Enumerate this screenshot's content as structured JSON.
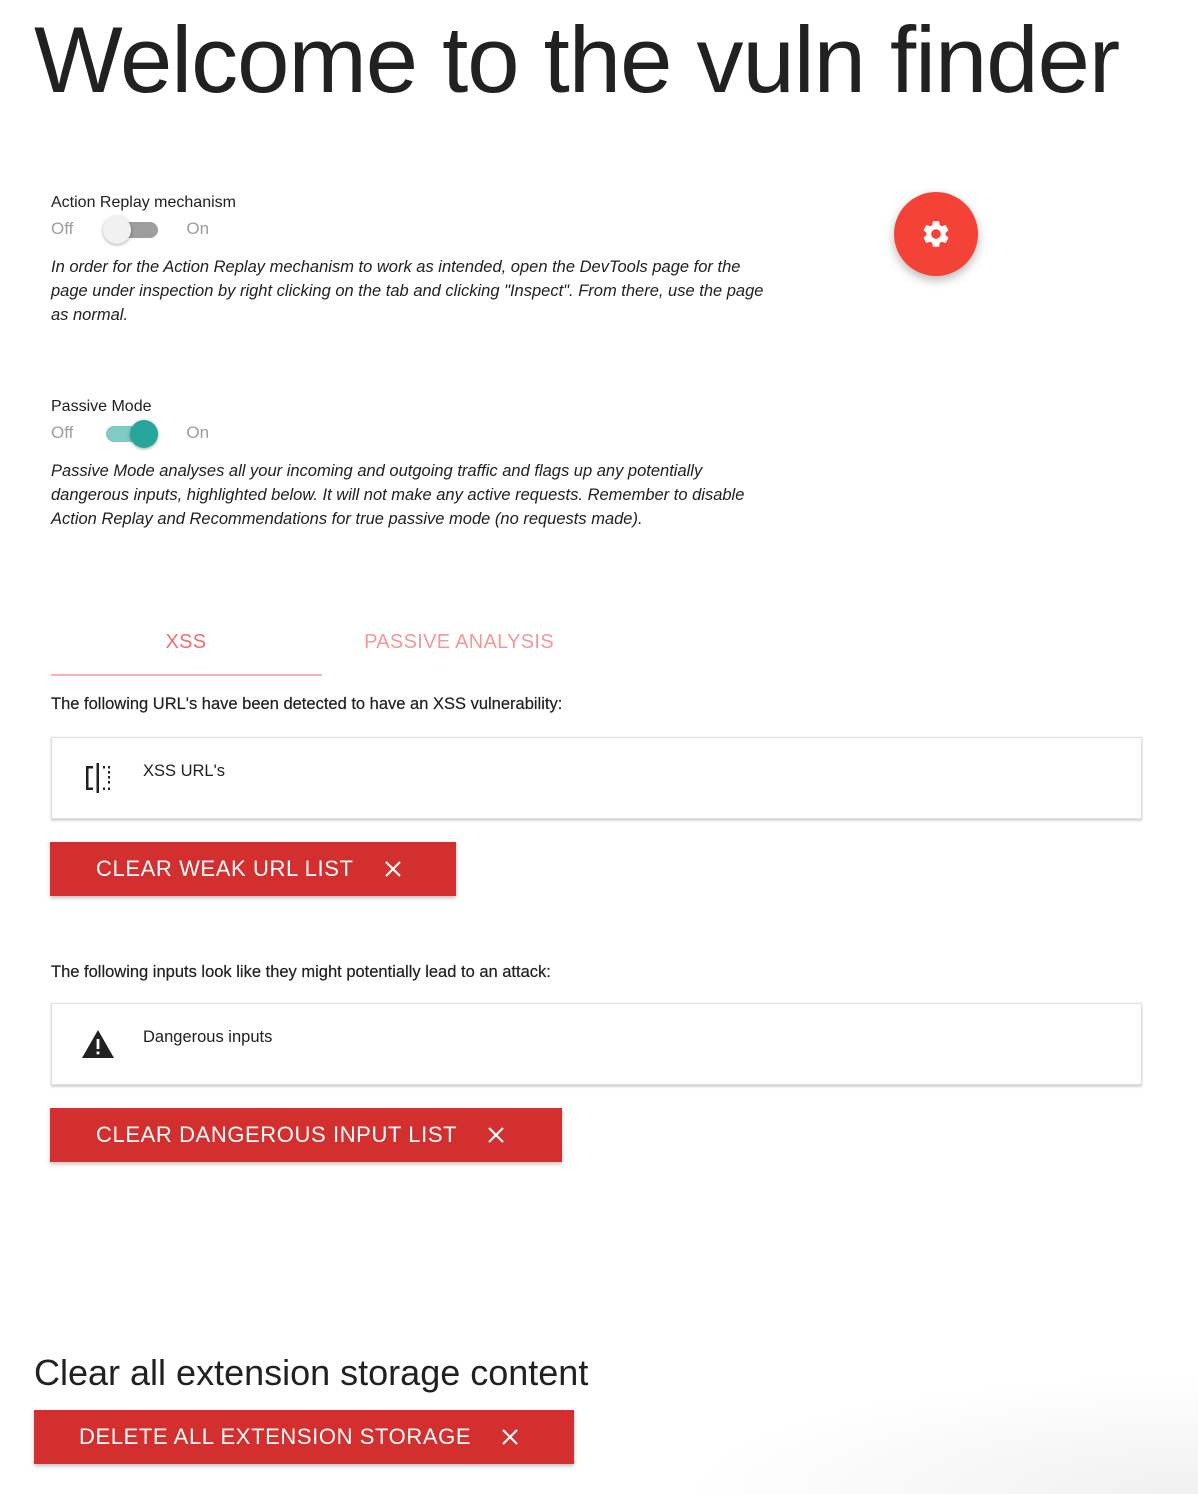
{
  "page": {
    "title": "Welcome to the vuln finder"
  },
  "action_replay": {
    "label": "Action Replay mechanism",
    "off_label": "Off",
    "on_label": "On",
    "state": "off",
    "description": "In order for the Action Replay mechanism to work as intended, open the DevTools page for the page under inspection by right clicking on the tab and clicking \"Inspect\". From there, use the page as normal."
  },
  "passive_mode": {
    "label": "Passive Mode",
    "off_label": "Off",
    "on_label": "On",
    "state": "on",
    "description": "Passive Mode analyses all your incoming and outgoing traffic and flags up any potentially dangerous inputs, highlighted below. It will not make any active requests. Remember to disable Action Replay and Recommendations for true passive mode (no requests made)."
  },
  "settings_button": {
    "icon": "gear-icon",
    "color": "#f44336"
  },
  "tabs": [
    {
      "label": "XSS",
      "active": true
    },
    {
      "label": "PASSIVE ANALYSIS",
      "active": false
    }
  ],
  "xss_section": {
    "intro": "The following URL's have been detected to have an XSS vulnerability:",
    "collection_label": "XSS URL's",
    "collection_icon": "compare-icon",
    "clear_button": "CLEAR WEAK URL LIST"
  },
  "inputs_section": {
    "intro": "The following inputs look like they might potentially lead to an attack:",
    "collection_label": "Dangerous inputs",
    "collection_icon": "warning-icon",
    "clear_button": "CLEAR DANGEROUS INPUT LIST"
  },
  "storage_section": {
    "title": "Clear all extension storage content",
    "delete_button": "DELETE ALL EXTENSION STORAGE"
  },
  "colors": {
    "button_red": "#d32f2f",
    "tab_red": "#ee6e73",
    "switch_on": "#26a69a",
    "fab_red": "#f44336"
  }
}
